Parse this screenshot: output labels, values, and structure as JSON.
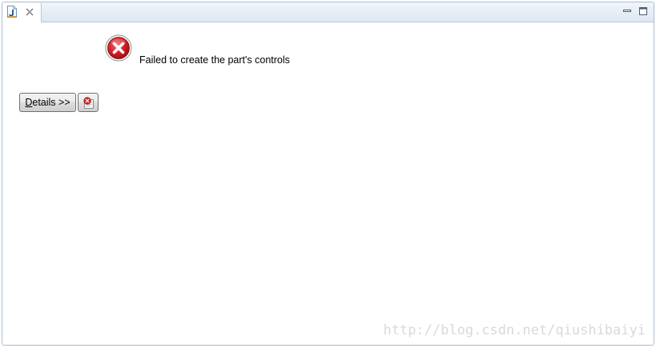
{
  "tab": {
    "icon": "java-file-icon",
    "close_icon": "close-icon"
  },
  "window_controls": {
    "minimize_icon": "minimize-icon",
    "maximize_icon": "maximize-icon"
  },
  "error": {
    "icon": "error-icon",
    "message": "Failed to create the part's controls"
  },
  "buttons": {
    "details_mnemonic": "D",
    "details_rest": "etails >>",
    "error_log_icon": "error-log-icon"
  },
  "watermark": "http://blog.csdn.net/qiushibaiyi",
  "colors": {
    "error_red": "#c8171d",
    "tabbar_blue": "#dde7f4"
  }
}
